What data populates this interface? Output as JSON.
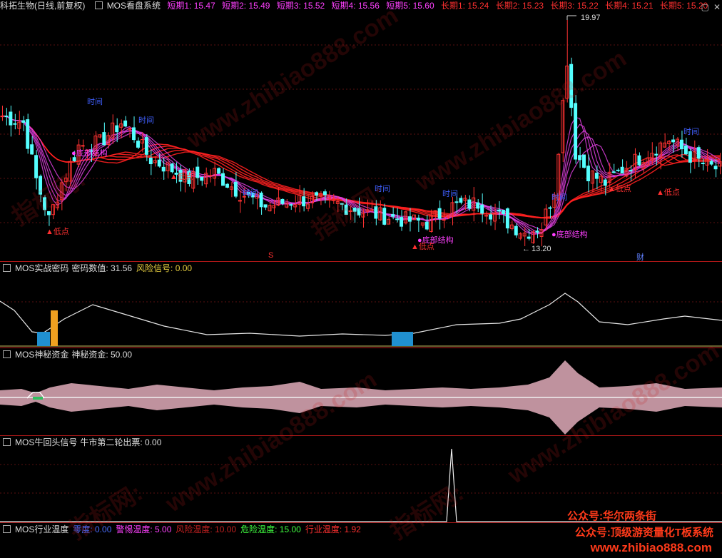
{
  "main": {
    "stock": "科拓生物",
    "period": "(日线,前复权)",
    "indicator": "MOS看盘系统",
    "short_labels": [
      "短期1: 15.47",
      "短期2: 15.49",
      "短期3: 15.52",
      "短期4: 15.56",
      "短期5: 15.60"
    ],
    "long_labels": [
      "长期1: 15.24",
      "长期2: 15.23",
      "长期3: 15.22",
      "长期4: 15.21",
      "长期5: 15.20"
    ],
    "high_label": "19.97",
    "low_label": "13.20",
    "marker_s": "S",
    "marker_cai": "财",
    "ann_shiji": "时间",
    "ann_dijiegou": "●底部结构",
    "ann_didian": "▲低点",
    "colors": {
      "up": "#ff3232",
      "down": "#54ffff",
      "short_ma": "#e040e0",
      "long_ma": "#ff2020",
      "pink": "#ff40ff",
      "blue": "#4060ff"
    }
  },
  "panel1": {
    "name": "MOS实战密码",
    "label": "密码数值: 31.56",
    "risk": "风险信号: 0.00"
  },
  "panel2": {
    "name": "MOS神秘资金",
    "label": "神秘资金: 50.00"
  },
  "panel3": {
    "name": "MOS牛回头信号",
    "label": "牛市第二轮出票: 0.00"
  },
  "panel4": {
    "name": "MOS行业温度",
    "items": [
      {
        "text": "零度: 0.00",
        "color": "#4a6cff"
      },
      {
        "text": "警惕温度: 5.00",
        "color": "#ff40ff"
      },
      {
        "text": "风险温度: 10.00",
        "color": "#c02020"
      },
      {
        "text": "危险温度: 15.00",
        "color": "#40ff40"
      },
      {
        "text": "行业温度: 1.92",
        "color": "#ff3030"
      }
    ]
  },
  "promo": {
    "line1": "公众号:华尔两条街",
    "line2": "公众号:顶级游资量化T板系统",
    "line3": "www.zhibiao888.com"
  },
  "watermarks": {
    "site": "www.zhibiao888.com",
    "cn": "指标网:"
  },
  "controls": {
    "minimize": "▢",
    "close": "✕"
  },
  "chart_data": {
    "type": "candlestick",
    "title": "科拓生物 (日线,前复权) MOS看盘系统",
    "price_high": 19.97,
    "price_low": 13.2,
    "short_ma_last": [
      15.47,
      15.49,
      15.52,
      15.56,
      15.6
    ],
    "long_ma_last": [
      15.24,
      15.23,
      15.22,
      15.21,
      15.2
    ],
    "mima_value": 31.56,
    "risk_signal": 0.0,
    "shenmi_zijin": 50.0,
    "niuhuitou": 0.0,
    "temperature_levels": [
      0,
      5,
      10,
      15
    ],
    "industry_temperature": 1.92
  }
}
